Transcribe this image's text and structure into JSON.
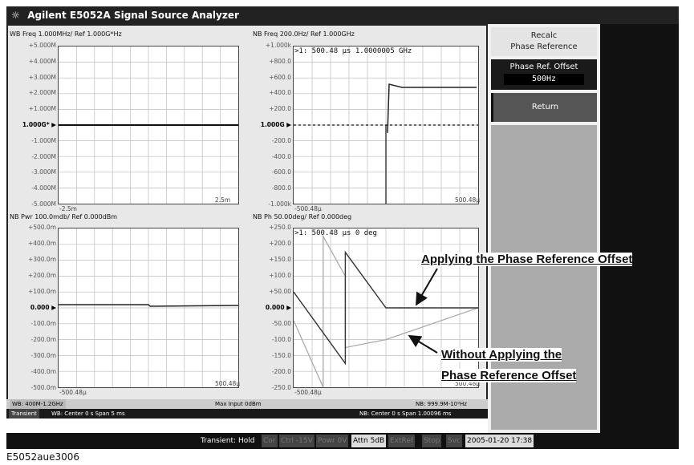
{
  "window": {
    "title": "Agilent E5052A Signal Source Analyzer",
    "icon": "sun-logo-icon"
  },
  "panels": [
    {
      "id": "wb-freq",
      "title": "WB Freq 1.000MHz/ Ref 1.000G*Hz",
      "ylabels": [
        "+5.000M",
        "+4.000M",
        "+3.000M",
        "+2.000M",
        "+1.000M",
        "1.000G*",
        "-1.000M",
        "-2.000M",
        "-3.000M",
        "-4.000M",
        "-5.000M"
      ],
      "xlabels": [
        "-2.5m",
        "2.5m"
      ]
    },
    {
      "id": "nb-freq",
      "title": "NB Freq 200.0Hz/ Ref 1.000GHz",
      "ylabels": [
        "+1.000k",
        "+800.0",
        "+600.0",
        "+400.0",
        "+200.0",
        "1.000G",
        "-200.0",
        "-400.0",
        "-600.0",
        "-800.0",
        "-1.000k"
      ],
      "xlabels": [
        "-500.48μ",
        "500.48μ"
      ],
      "marker": ">1:  500.48 μs   1.0000005 GHz"
    },
    {
      "id": "nb-pwr",
      "title": "NB Pwr 100.0mdb/ Ref 0.000dBm",
      "ylabels": [
        "+500.0m",
        "+400.0m",
        "+300.0m",
        "+200.0m",
        "+100.0m",
        "0.000",
        "-100.0m",
        "-200.0m",
        "-300.0m",
        "-400.0m",
        "-500.0m"
      ],
      "xlabels": [
        "-500.48μ",
        "500.48μ"
      ]
    },
    {
      "id": "nb-ph",
      "title": "NB Ph 50.00deg/ Ref 0.000deg",
      "ylabels": [
        "+250.0",
        "+200.0",
        "+150.0",
        "+100.0",
        "+50.00",
        "0.000",
        "-50.00",
        "-100.0",
        "-150.0",
        "-200.0",
        "-250.0"
      ],
      "xlabels": [
        "-500.48μ",
        "500.48μ"
      ],
      "marker": ">1:  500.48 μs    0 deg"
    }
  ],
  "status": {
    "wb_range": "WB: 400M-1.2GHz",
    "max_input": "Max Input 0dBm",
    "nb_range": "NB: 999.9M-10⁹Hz"
  },
  "info": {
    "mode": "Transient",
    "wb": "WB: Center 0 s  Span 5 ms",
    "nb": "NB: Center 0 s  Span 1.00096 ms"
  },
  "softkeys": {
    "recalc_line1": "Recalc",
    "recalc_line2": "Phase Reference",
    "offset_label": "Phase Ref. Offset",
    "offset_value": "500Hz",
    "return_label": "Return"
  },
  "bottom": {
    "transient": "Transient: Hold",
    "cor": "Cor",
    "ctrl": "Ctrl -15V",
    "powr": "Powr 0V",
    "attn": "Attn 5dB",
    "extref": "ExtRef",
    "stop": "Stop",
    "svc": "Svc",
    "datetime": "2005-01-20 17:38"
  },
  "annotations": {
    "applying": "Applying the Phase Reference Offset",
    "without_1": "Without Applying the",
    "without_2": "Phase Reference Offset"
  },
  "caption": "E5052aue3006"
}
